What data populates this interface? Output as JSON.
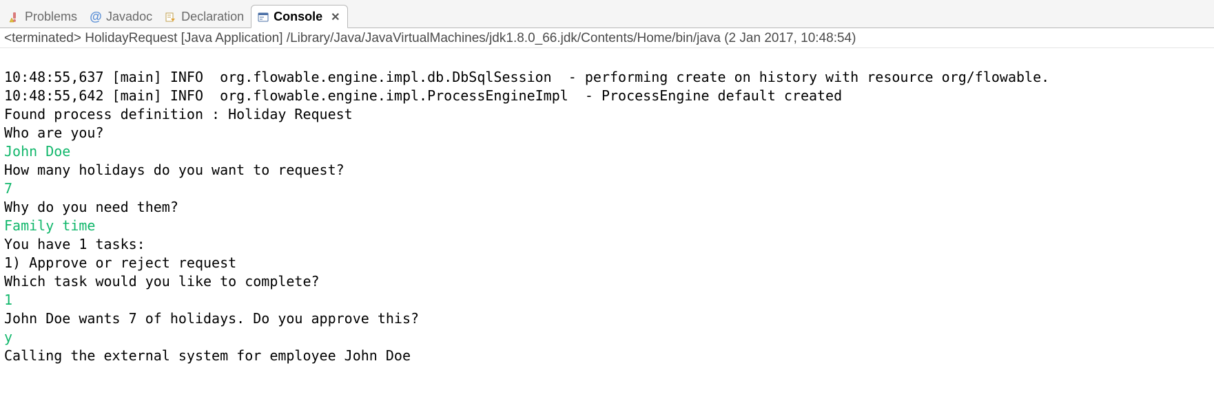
{
  "tabs": {
    "problems": {
      "label": "Problems"
    },
    "javadoc": {
      "label": "Javadoc",
      "at": "@"
    },
    "declaration": {
      "label": "Declaration"
    },
    "console": {
      "label": "Console",
      "close": "✕"
    }
  },
  "status": "<terminated> HolidayRequest [Java Application] /Library/Java/JavaVirtualMachines/jdk1.8.0_66.jdk/Contents/Home/bin/java (2 Jan 2017, 10:48:54)",
  "console_lines": {
    "l1": "10:48:55,637 [main] INFO  org.flowable.engine.impl.db.DbSqlSession  - performing create on history with resource org/flowable.",
    "l2": "10:48:55,642 [main] INFO  org.flowable.engine.impl.ProcessEngineImpl  - ProcessEngine default created",
    "l3": "Found process definition : Holiday Request",
    "l4": "Who are you?",
    "l5": "John Doe",
    "l6": "How many holidays do you want to request?",
    "l7": "7",
    "l8": "Why do you need them?",
    "l9": "Family time",
    "l10": "You have 1 tasks:",
    "l11": "1) Approve or reject request",
    "l12": "Which task would you like to complete?",
    "l13": "1",
    "l14": "John Doe wants 7 of holidays. Do you approve this?",
    "l15": "y",
    "l16": "Calling the external system for employee John Doe"
  }
}
